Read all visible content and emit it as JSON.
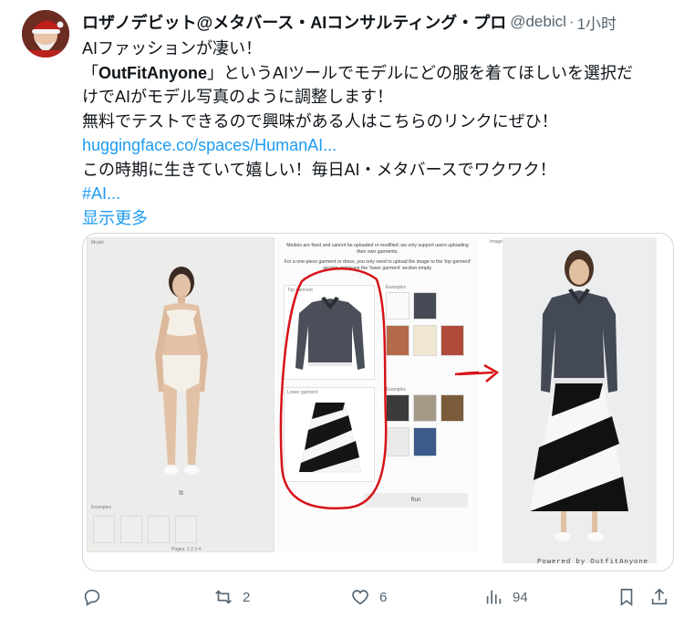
{
  "tweet": {
    "display_name": "ロザノデビット@メタバース・AIコンサルティング・プロ",
    "handle": "@debicl",
    "separator": "·",
    "time": "1小时",
    "more_icon": "more-icon",
    "lines": [
      "AIファッションが凄い！",
      "」というAIツールでモデルにどの服を着てほしいを選択だ",
      "けでAIがモデル写真のように調整します！",
      "無料でテストできるので興味がある人はこちらのリンクにぜひ！",
      "この時期に生きていて嬉しい！毎日AI・メタバースでワクワク！"
    ],
    "quote_open": "「",
    "tool_name": "OutFitAnyone",
    "link": "huggingface.co/spaces/HumanAI...",
    "hashtag": "#AI...",
    "show_more": "显示更多"
  },
  "media": {
    "left_label": "Model",
    "examples_label": "Examples",
    "pages_label": "Pages: 1 2 3 4",
    "note_1": "Models are fixed and cannot be uploaded or modified; we only support users uploading their own garments.",
    "note_2": "For a one-piece garment or dress, you only need to upload the image to the 'top garment' section and leave the 'lower garment' section empty.",
    "top_garment_label": "Top garment",
    "lower_garment_label": "Lower garment",
    "examples_top_label": "Examples",
    "examples_bottom_label": "Examples",
    "run_label": "Run",
    "image_label": "Image",
    "powered_by": "Powered by OutfitAnyone",
    "annotation_color": "#d7141a"
  },
  "actions": {
    "reply_icon": "reply-icon",
    "retweet_icon": "retweet-icon",
    "retweet_count": "2",
    "like_icon": "heart-icon",
    "like_count": "6",
    "views_icon": "views-icon",
    "views_count": "94",
    "bookmark_icon": "bookmark-icon",
    "share_icon": "share-icon"
  }
}
